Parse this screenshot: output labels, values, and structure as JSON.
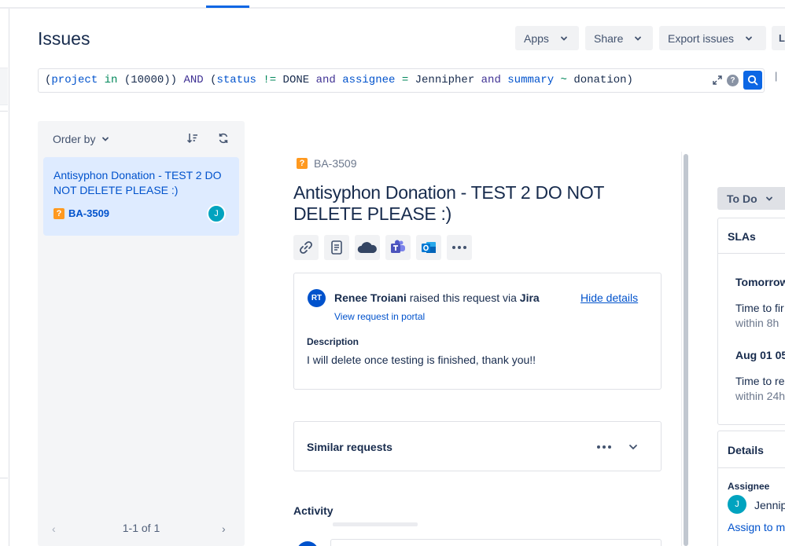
{
  "page": {
    "title": "Issues"
  },
  "header_buttons": {
    "apps": "Apps",
    "share": "Share",
    "export": "Export issues",
    "more": "LI"
  },
  "jql": {
    "p1": "(",
    "project_field": "project",
    "in_op": "in",
    "p2": "(10000)) ",
    "and1": "AND",
    "p3": " (",
    "status_field": "status",
    "neq_op": "!=",
    "done_val": "DONE",
    "and2": "and",
    "assignee_field": "assignee",
    "eq_op": "=",
    "assignee_val": "Jennipher",
    "and3": "and",
    "summary_field": "summary",
    "tilde_op": "~",
    "summary_val": "donation)",
    "help_glyph": "?"
  },
  "list": {
    "order_by": "Order by",
    "items": [
      {
        "summary": "Antisyphon Donation - TEST 2 DO NOT DELETE PLEASE :)",
        "key": "BA-3509",
        "avatar": "J"
      }
    ],
    "pagination": {
      "prev": "‹",
      "count": "1-1 of 1",
      "next": "›"
    }
  },
  "detail": {
    "key": "BA-3509",
    "title": "Antisyphon Donation - TEST 2 DO NOT DELETE PLEASE :)",
    "request": {
      "avatar_initials": "RT",
      "reporter": "Renee Troiani",
      "raised_text": "raised this request via",
      "channel": "Jira",
      "hide_details": "Hide details",
      "view_portal": "View request in portal",
      "description_label": "Description",
      "description": "I will delete once testing is finished, thank you!!"
    },
    "similar_requests": "Similar requests",
    "activity": "Activity"
  },
  "side": {
    "status": "To Do",
    "sla_title": "SLAs",
    "sla": [
      {
        "when": "Tomorrow",
        "name": "Time to fir",
        "within": "within 8h"
      },
      {
        "when": "Aug 01 05",
        "name": "Time to re",
        "within": "within 24h"
      }
    ],
    "details_title": "Details",
    "assignee_label": "Assignee",
    "assignee_avatar": "J",
    "assignee_name": "Jennip",
    "assign_to_me": "Assign to m"
  },
  "colors": {
    "accent": "#0c66e4",
    "link": "#0052cc",
    "selected_card": "#deebff",
    "question_icon": "#ff991f"
  },
  "icons": [
    "link-icon",
    "document-icon",
    "onedrive-icon",
    "teams-icon",
    "outlook-icon",
    "more-icon"
  ]
}
